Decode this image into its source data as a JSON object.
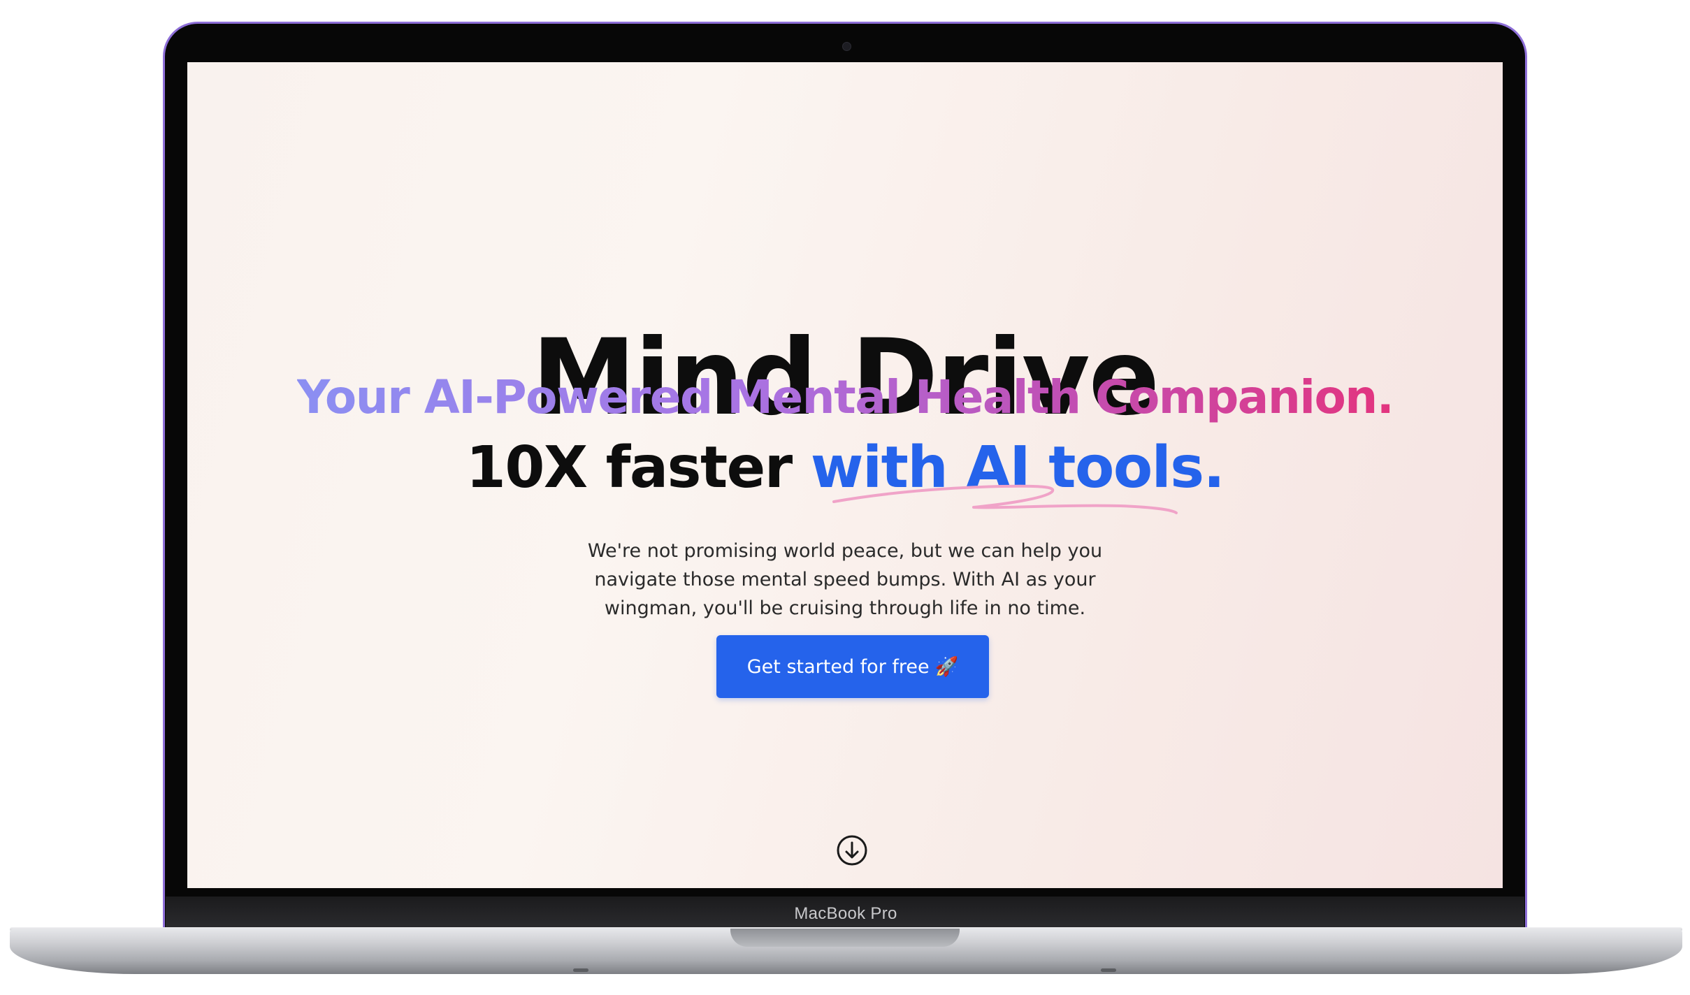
{
  "device": {
    "label": "MacBook Pro"
  },
  "hero": {
    "title": "Mind Drive",
    "subtitle": "Your AI-Powered Mental Health Companion.",
    "tagline_plain": "10X faster ",
    "tagline_accent": "with AI tools.",
    "description": "We're not promising world peace, but we can help you navigate those mental speed bumps. With AI as your wingman, you'll be cruising through life in no time.",
    "cta_label": "Get started for free",
    "cta_emoji": "🚀"
  },
  "icons": {
    "scroll": "arrow-down-circle-icon",
    "underline": "scribble-underline-icon"
  },
  "colors": {
    "accent_blue": "#2563eb",
    "subtitle_gradient_start": "#8b8ff2",
    "subtitle_gradient_end": "#e3347e",
    "scribble_pink": "#f0a3c8",
    "frame_accent": "#8e6fd8"
  }
}
